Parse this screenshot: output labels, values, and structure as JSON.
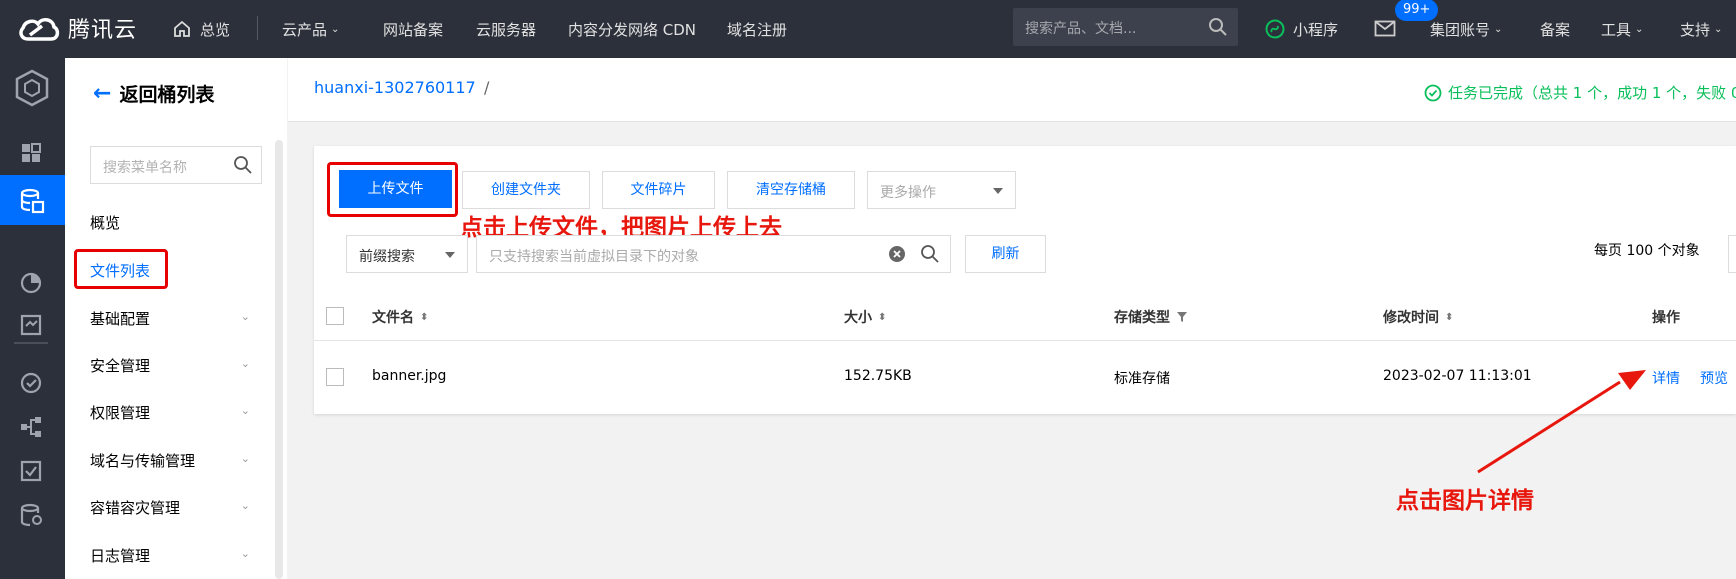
{
  "topbar": {
    "logo_text": "腾讯云",
    "overview": "总览",
    "cloud_products": "云产品",
    "nav_items": [
      "网站备案",
      "云服务器",
      "内容分发网络 CDN",
      "域名注册"
    ],
    "search_placeholder": "搜索产品、文档...",
    "mini_program": "小程序",
    "mail_badge": "99+",
    "group_account": "集团账号",
    "icp": "备案",
    "tools": "工具",
    "support": "支持"
  },
  "sidebar": {
    "back_label": "返回桶列表",
    "search_placeholder": "搜索菜单名称",
    "items": [
      {
        "label": "概览"
      },
      {
        "label": "文件列表"
      },
      {
        "label": "基础配置"
      },
      {
        "label": "安全管理"
      },
      {
        "label": "权限管理"
      },
      {
        "label": "域名与传输管理"
      },
      {
        "label": "容错容灾管理"
      },
      {
        "label": "日志管理"
      }
    ]
  },
  "breadcrumb": {
    "bucket": "huanxi-1302760117",
    "separator": "/",
    "task_status": "任务已完成（总共 1 个，成功 1 个，失败 0"
  },
  "toolbar": {
    "upload": "上传文件",
    "create_folder": "创建文件夹",
    "fragments": "文件碎片",
    "clear_bucket": "清空存储桶",
    "more_actions": "更多操作",
    "prefix_search": "前缀搜索",
    "search_placeholder": "只支持搜索当前虚拟目录下的对象",
    "refresh": "刷新",
    "page_size": "每页 100 个对象"
  },
  "annotations": {
    "upload_hint": "点击上传文件，把图片上传上去",
    "detail_hint": "点击图片详情"
  },
  "table": {
    "headers": {
      "name": "文件名",
      "size": "大小",
      "storage": "存储类型",
      "modified": "修改时间",
      "actions": "操作"
    },
    "rows": [
      {
        "name": "banner.jpg",
        "size": "152.75KB",
        "storage": "标准存储",
        "modified": "2023-02-07 11:13:01",
        "detail": "详情",
        "preview": "预览"
      }
    ]
  },
  "colors": {
    "accent": "#006eff",
    "annotation": "#e8170e",
    "success": "#0abf5b",
    "topbar": "#2c303b"
  }
}
